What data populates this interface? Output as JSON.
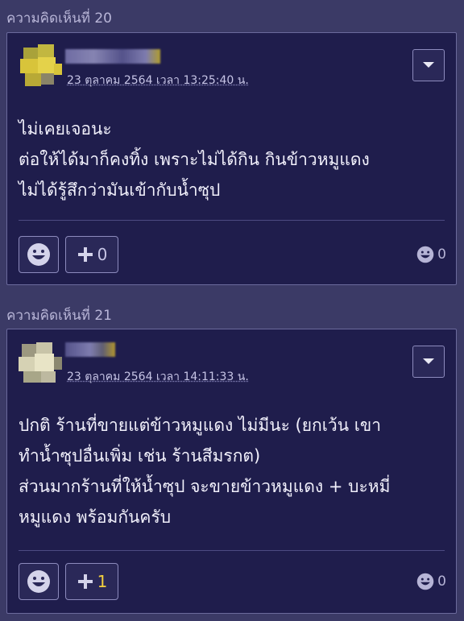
{
  "comments": [
    {
      "header": "ความคิดเห็นที่ 20",
      "timestamp": "23 ตุลาคม 2564 เวลา 13:25:40 น.",
      "lines": [
        "ไม่เคยเจอนะ",
        "ต่อให้ได้มาก็คงทิ้ง เพราะไม่ได้กิน กินข้าวหมูแดง",
        "ไม่ได้รู้สึกว่ามันเข้ากับน้ำซุป"
      ],
      "plus_count": "0",
      "emoji_count": "0"
    },
    {
      "header": "ความคิดเห็นที่ 21",
      "timestamp": "23 ตุลาคม 2564 เวลา 14:11:33 น.",
      "lines": [
        "ปกติ ร้านที่ขายแต่ข้าวหมูแดง ไม่มีนะ (ยกเว้น เขา",
        "ทำน้ำซุปอื่นเพิ่ม เช่น ร้านสีมรกต)",
        "ส่วนมากร้านที่ให้น้ำซุป จะขายข้าวหมูแดง + บะหมี่",
        "หมูแดง พร้อมกันครับ"
      ],
      "plus_count": "1",
      "emoji_count": "0"
    }
  ],
  "colors": {
    "background": "#3b3a66",
    "card": "#1f1d4c",
    "border": "#6b6a9c",
    "highlight": "#f3d03e"
  }
}
